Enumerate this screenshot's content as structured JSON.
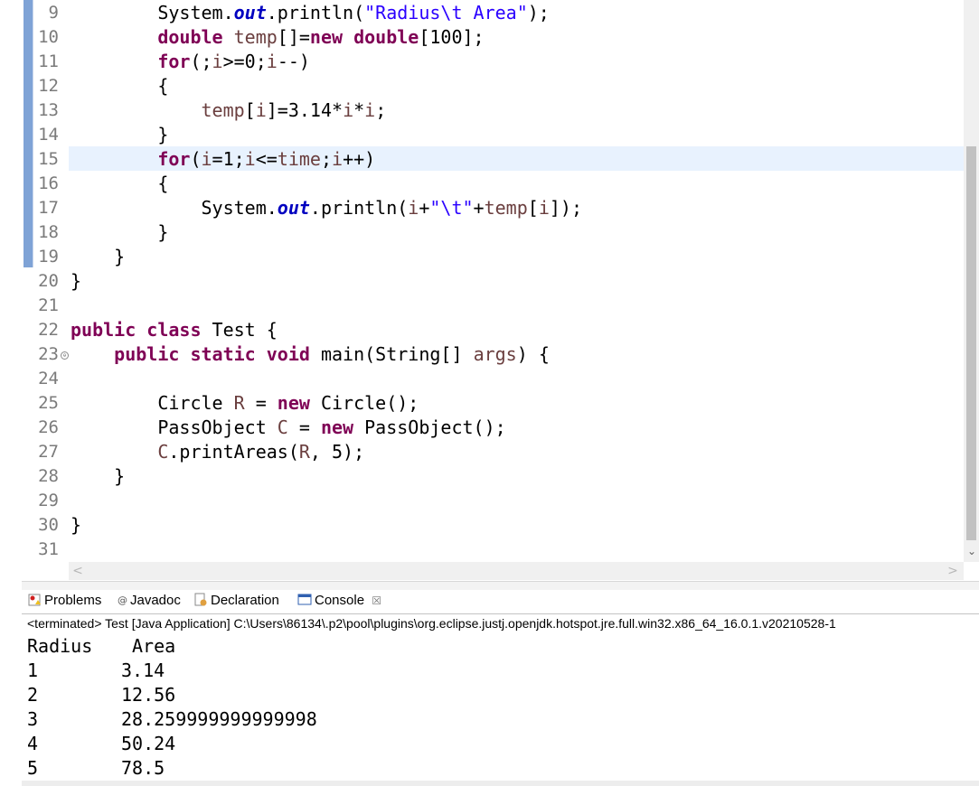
{
  "editor": {
    "lines": [
      {
        "num": "9",
        "tokens": [
          [
            "t",
            "        System."
          ],
          [
            "fld",
            "out"
          ],
          [
            "t",
            ".println("
          ],
          [
            "str",
            "\"Radius\\t Area\""
          ],
          [
            "t",
            ");"
          ]
        ]
      },
      {
        "num": "10",
        "tokens": [
          [
            "t",
            "        "
          ],
          [
            "kw",
            "double"
          ],
          [
            "t",
            " "
          ],
          [
            "var",
            "temp"
          ],
          [
            "t",
            "[]="
          ],
          [
            "kw",
            "new"
          ],
          [
            "t",
            " "
          ],
          [
            "kw",
            "double"
          ],
          [
            "t",
            "[100];"
          ]
        ]
      },
      {
        "num": "11",
        "tokens": [
          [
            "t",
            "        "
          ],
          [
            "kw",
            "for"
          ],
          [
            "t",
            "(;"
          ],
          [
            "var",
            "i"
          ],
          [
            "t",
            ">=0;"
          ],
          [
            "var",
            "i"
          ],
          [
            "t",
            "--)"
          ]
        ]
      },
      {
        "num": "12",
        "tokens": [
          [
            "t",
            "        {"
          ]
        ]
      },
      {
        "num": "13",
        "tokens": [
          [
            "t",
            "            "
          ],
          [
            "var",
            "temp"
          ],
          [
            "t",
            "["
          ],
          [
            "var",
            "i"
          ],
          [
            "t",
            "]=3.14*"
          ],
          [
            "var",
            "i"
          ],
          [
            "t",
            "*"
          ],
          [
            "var",
            "i"
          ],
          [
            "t",
            ";"
          ]
        ]
      },
      {
        "num": "14",
        "tokens": [
          [
            "t",
            "        }"
          ]
        ]
      },
      {
        "num": "15",
        "tokens": [
          [
            "t",
            "        "
          ],
          [
            "kw",
            "for"
          ],
          [
            "t",
            "("
          ],
          [
            "var",
            "i"
          ],
          [
            "t",
            "=1;"
          ],
          [
            "var",
            "i"
          ],
          [
            "t",
            "<="
          ],
          [
            "var",
            "time"
          ],
          [
            "t",
            ";"
          ],
          [
            "var",
            "i"
          ],
          [
            "t",
            "++)"
          ]
        ]
      },
      {
        "num": "16",
        "tokens": [
          [
            "t",
            "        {"
          ]
        ]
      },
      {
        "num": "17",
        "tokens": [
          [
            "t",
            "            System."
          ],
          [
            "fld",
            "out"
          ],
          [
            "t",
            ".println("
          ],
          [
            "var",
            "i"
          ],
          [
            "t",
            "+"
          ],
          [
            "str",
            "\"\\t\""
          ],
          [
            "t",
            "+"
          ],
          [
            "var",
            "temp"
          ],
          [
            "t",
            "["
          ],
          [
            "var",
            "i"
          ],
          [
            "t",
            "]);"
          ]
        ]
      },
      {
        "num": "18",
        "tokens": [
          [
            "t",
            "        }"
          ]
        ]
      },
      {
        "num": "19",
        "tokens": [
          [
            "t",
            "    }"
          ]
        ]
      },
      {
        "num": "20",
        "tokens": [
          [
            "t",
            "}"
          ]
        ]
      },
      {
        "num": "21",
        "tokens": []
      },
      {
        "num": "22",
        "tokens": [
          [
            "kw",
            "public"
          ],
          [
            "t",
            " "
          ],
          [
            "kw",
            "class"
          ],
          [
            "t",
            " Test {"
          ]
        ]
      },
      {
        "num": "23",
        "tokens": [
          [
            "t",
            "    "
          ],
          [
            "kw",
            "public"
          ],
          [
            "t",
            " "
          ],
          [
            "kw",
            "static"
          ],
          [
            "t",
            " "
          ],
          [
            "kw",
            "void"
          ],
          [
            "t",
            " main(String[] "
          ],
          [
            "var",
            "args"
          ],
          [
            "t",
            ") {"
          ]
        ]
      },
      {
        "num": "24",
        "tokens": []
      },
      {
        "num": "25",
        "tokens": [
          [
            "t",
            "        Circle "
          ],
          [
            "var",
            "R"
          ],
          [
            "t",
            " = "
          ],
          [
            "kw",
            "new"
          ],
          [
            "t",
            " Circle();"
          ]
        ]
      },
      {
        "num": "26",
        "tokens": [
          [
            "t",
            "        PassObject "
          ],
          [
            "var",
            "C"
          ],
          [
            "t",
            " = "
          ],
          [
            "kw",
            "new"
          ],
          [
            "t",
            " PassObject();"
          ]
        ]
      },
      {
        "num": "27",
        "tokens": [
          [
            "t",
            "        "
          ],
          [
            "var",
            "C"
          ],
          [
            "t",
            ".printAreas("
          ],
          [
            "var",
            "R"
          ],
          [
            "t",
            ", 5);"
          ]
        ]
      },
      {
        "num": "28",
        "tokens": [
          [
            "t",
            "    }"
          ]
        ]
      },
      {
        "num": "29",
        "tokens": []
      },
      {
        "num": "30",
        "tokens": [
          [
            "t",
            "}"
          ]
        ]
      },
      {
        "num": "31",
        "tokens": []
      }
    ],
    "fold_marker": "⊖",
    "scroll_down_glyph": "⌄",
    "scroll_left_glyph": "<",
    "scroll_right_glyph": ">"
  },
  "views": {
    "tabs": [
      {
        "label": "Problems",
        "icon": "problems-icon"
      },
      {
        "label": "Javadoc",
        "icon": "javadoc-icon"
      },
      {
        "label": "Declaration",
        "icon": "declaration-icon"
      },
      {
        "label": "Console",
        "icon": "console-icon",
        "active": true
      }
    ],
    "close_glyph": "☒"
  },
  "console": {
    "status": "<terminated> Test [Java Application] C:\\Users\\86134\\.p2\\pool\\plugins\\org.eclipse.justj.openjdk.hotspot.jre.full.win32.x86_64_16.0.1.v20210528-1",
    "output": [
      [
        "Radius",
        "Area"
      ],
      [
        "1",
        "3.14"
      ],
      [
        "2",
        "12.56"
      ],
      [
        "3",
        "28.259999999999998"
      ],
      [
        "4",
        "50.24"
      ],
      [
        "5",
        "78.5"
      ]
    ]
  }
}
